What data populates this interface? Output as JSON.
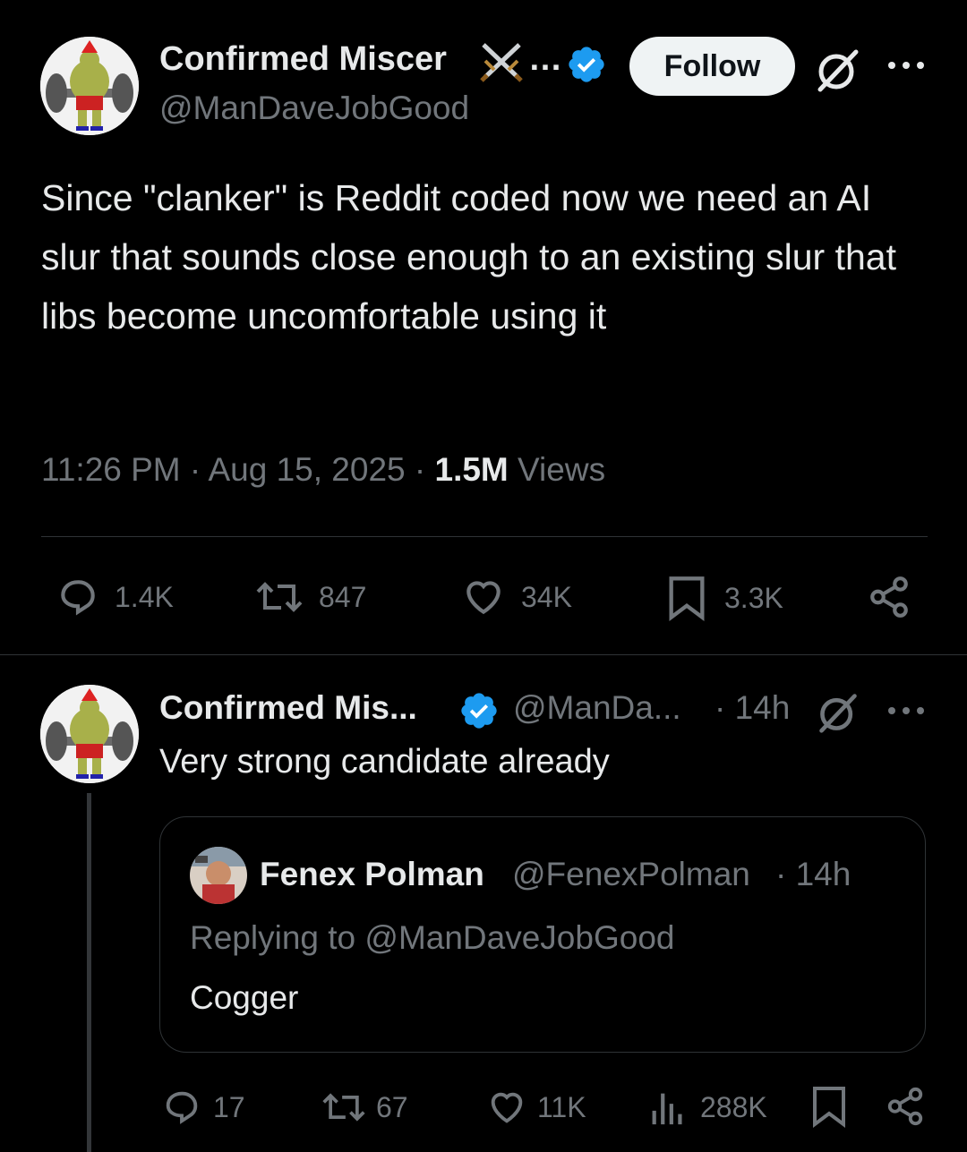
{
  "main_tweet": {
    "author_name": "Confirmed Miscer",
    "author_ellipsis": "…",
    "handle": "@ManDaveJobGood",
    "follow_label": "Follow",
    "text": "Since \"clanker\" is Reddit coded now we need an AI slur that sounds close enough to an existing slur that libs become uncomfortable using it",
    "time": "11:26 PM",
    "date": "Aug 15, 2025",
    "views_count": "1.5M",
    "views_label": "Views",
    "stats": {
      "replies": "1.4K",
      "reposts": "847",
      "likes": "34K",
      "bookmarks": "3.3K"
    }
  },
  "reply_tweet": {
    "author_name": "Confirmed Mis...",
    "handle": "@ManDa...",
    "age": "· 14h",
    "text": "Very strong candidate already",
    "stats": {
      "replies": "17",
      "reposts": "67",
      "likes": "11K",
      "views": "288K"
    }
  },
  "quoted_tweet": {
    "author_name": "Fenex Polman",
    "handle": "@FenexPolman",
    "age": "· 14h",
    "replying_to": "Replying to @ManDaveJobGood",
    "text": "Cogger"
  },
  "colors": {
    "background": "#000000",
    "text": "#e7e9ea",
    "muted": "#71767b",
    "verified": "#1d9bf0",
    "divider": "#2f3336"
  },
  "icons": [
    "avatar",
    "crossed-swords-icon",
    "verified-badge-icon",
    "grok-icon",
    "more-icon",
    "reply-icon",
    "repost-icon",
    "like-icon",
    "bookmark-icon",
    "share-icon",
    "views-icon"
  ]
}
